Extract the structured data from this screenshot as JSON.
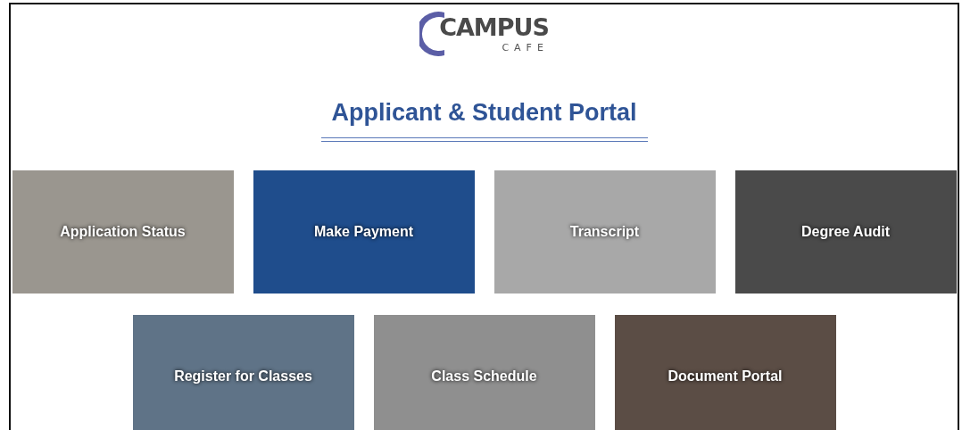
{
  "logo": {
    "name": "CAMPUS",
    "subtitle": "CAFE"
  },
  "title": "Applicant & Student Portal",
  "tile_rows": [
    [
      {
        "label": "Application Status"
      },
      {
        "label": "Make Payment"
      },
      {
        "label": "Transcript"
      },
      {
        "label": "Degree Audit"
      }
    ],
    [
      {
        "label": "Register for Classes"
      },
      {
        "label": "Class Schedule"
      },
      {
        "label": "Document Portal"
      }
    ]
  ]
}
